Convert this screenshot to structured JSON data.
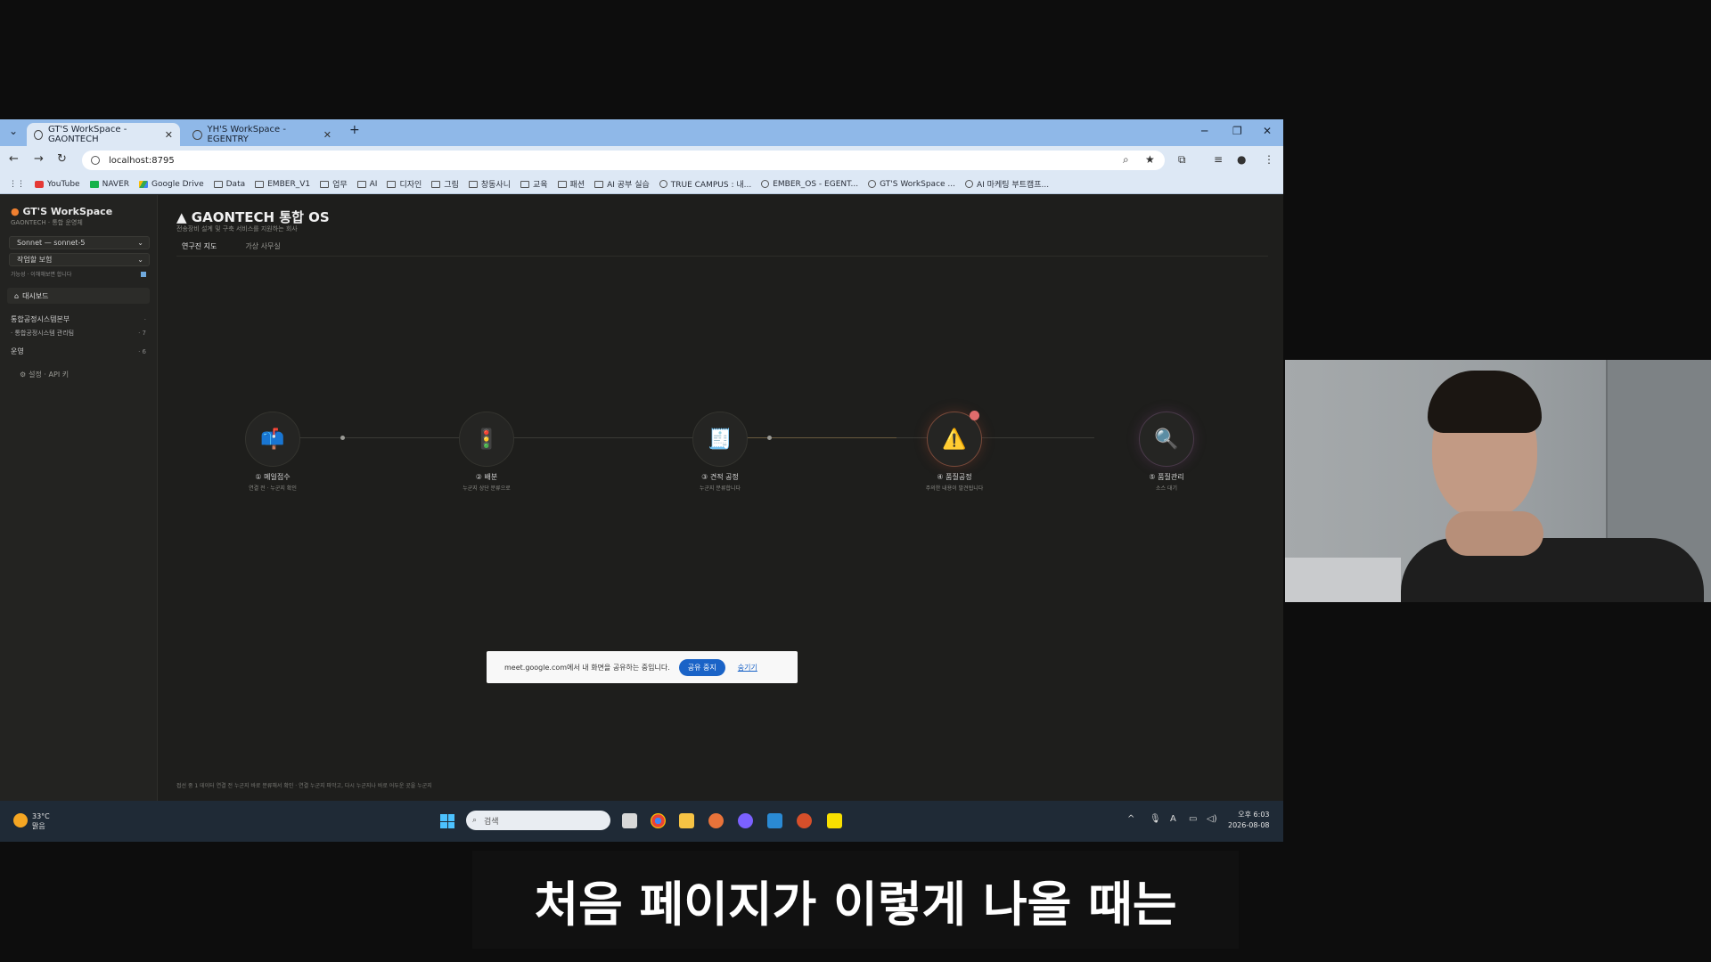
{
  "browser": {
    "tabs": [
      {
        "title": "GT'S WorkSpace - GAONTECH",
        "active": true
      },
      {
        "title": "YH'S WorkSpace - EGENTRY",
        "active": false
      }
    ],
    "new_tab": "+",
    "url": "localhost:8795",
    "bookmarks": [
      {
        "label": "YouTube",
        "icon": "youtube-icon"
      },
      {
        "label": "NAVER",
        "icon": "naver-icon"
      },
      {
        "label": "Google Drive",
        "icon": "google-drive-icon"
      },
      {
        "label": "Data",
        "icon": "folder-icon"
      },
      {
        "label": "EMBER_V1",
        "icon": "folder-icon"
      },
      {
        "label": "업무",
        "icon": "folder-icon"
      },
      {
        "label": "AI",
        "icon": "folder-icon"
      },
      {
        "label": "디자인",
        "icon": "folder-icon"
      },
      {
        "label": "그림",
        "icon": "folder-icon"
      },
      {
        "label": "창동사니",
        "icon": "folder-icon"
      },
      {
        "label": "교육",
        "icon": "folder-icon"
      },
      {
        "label": "패션",
        "icon": "folder-icon"
      },
      {
        "label": "AI 공부 실습",
        "icon": "folder-icon"
      },
      {
        "label": "TRUE CAMPUS : 내...",
        "icon": "globe-icon"
      },
      {
        "label": "EMBER_OS - EGENT...",
        "icon": "globe-icon"
      },
      {
        "label": "GT'S WorkSpace ...",
        "icon": "globe-icon"
      },
      {
        "label": "AI 마케팅 부트캠프...",
        "icon": "globe-icon"
      }
    ]
  },
  "sidebar": {
    "title": "GT'S WorkSpace",
    "subtitle": "GAONTECH · 통합 운영체",
    "model_select": "Sonnet — sonnet-5",
    "mode_select": "작업할 보험",
    "mode_note": "가능성 · 이해해보면 합니다",
    "dashboard": "대시보드",
    "items": [
      {
        "label": "통합공정시스템본부",
        "count": "·"
      },
      {
        "label": "· 통합공정시스템 관리팀",
        "count": "· 7"
      },
      {
        "label": "운영",
        "count": "· 6"
      }
    ],
    "settings": "설정 · API 키"
  },
  "main": {
    "title": "GAONTECH 통합 OS",
    "subtitle": "전송장비 설계 및 구축 서비스를 지원하는 회사",
    "tabs": [
      {
        "label": "연구진 지도",
        "active": true
      },
      {
        "label": "가상 사무실",
        "active": false
      }
    ],
    "flow_nodes": [
      {
        "name": "① 메일접수",
        "desc": "연결 전 · 누군지 확인",
        "icon": "mailbox-icon"
      },
      {
        "name": "② 배분",
        "desc": "누군지 상단 분류으로",
        "icon": "traffic-light-icon"
      },
      {
        "name": "③ 견적 공정",
        "desc": "누군지 분류합니다",
        "icon": "cash-register-icon"
      },
      {
        "name": "④ 품질공정",
        "desc": "주의한 내용이 발견됩니다",
        "icon": "warning-icon"
      },
      {
        "name": "⑤ 품질관리",
        "desc": "소스 대기",
        "icon": "magnifier-icon"
      }
    ],
    "footer_note": "접선 중 1 데이터 연결 전 누군지 바로 분류해서 확인 · 연결 누군지 파악고, 다시 누군지나 바로 어두운 곳을 누군지"
  },
  "share_bar": {
    "message": "meet.google.com에서 내 화면을 공유하는 중입니다.",
    "stop_label": "공유 중지",
    "hide_label": "숨기기"
  },
  "taskbar": {
    "temperature": "33°C",
    "weather": "맑음",
    "search_placeholder": "검색",
    "time": "오후 6:03",
    "date": "2026-08-08"
  },
  "subtitle": "처음 페이지가 이렇게 나올 때는",
  "colors": {
    "tab_strip": "#8fb8e8",
    "app_bg": "#1e1e1c",
    "taskbar": "#1f2a36",
    "share_stop": "#1a63c7"
  }
}
